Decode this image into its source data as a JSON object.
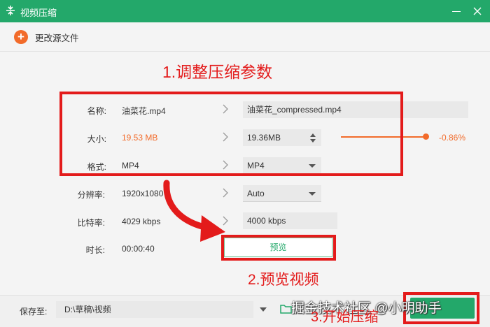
{
  "window": {
    "title": "视频压缩"
  },
  "toolbar": {
    "change_source_label": "更改源文件"
  },
  "annotations": {
    "step1": "1.调整压缩参数",
    "step2": "2.预览视频",
    "step3": "3.开始压缩",
    "watermark": "掘金技术社区 @小明助手"
  },
  "rows": {
    "name": {
      "label": "名称:",
      "source": "油菜花.mp4",
      "target": "油菜花_compressed.mp4"
    },
    "size": {
      "label": "大小:",
      "source": "19.53 MB",
      "target": "19.36MB",
      "percent": "-0.86%",
      "slider_fraction": 0.95
    },
    "format": {
      "label": "格式:",
      "source": "MP4",
      "target": "MP4"
    },
    "resolution": {
      "label": "分辨率:",
      "source": "1920x1080",
      "target": "Auto"
    },
    "bitrate": {
      "label": "比特率:",
      "source": "4029 kbps",
      "target": "4000 kbps"
    },
    "duration": {
      "label": "时长:",
      "source": "00:00:40"
    }
  },
  "preview_button": "预览",
  "bottom": {
    "save_label": "保存至:",
    "path": "D:\\草稿\\视频"
  },
  "colors": {
    "accent_green": "#23a86a",
    "accent_orange": "#f26b2a",
    "annotation_red": "#e31b1b"
  },
  "icons": {
    "app": "compress-icon",
    "change": "plus-circle-icon",
    "minimize": "minimize-icon",
    "close": "close-icon",
    "folder": "folder-icon"
  }
}
